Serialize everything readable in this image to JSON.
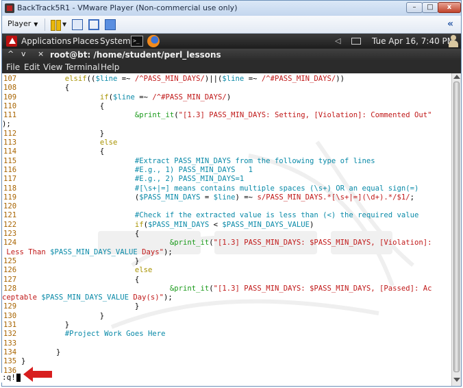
{
  "vmware": {
    "window_title": "BackTrack5R1 - VMware Player (Non-commercial use only)",
    "buttons": {
      "minimize": "–",
      "maximize": "□",
      "close": "x"
    },
    "toolbar": {
      "player_label": "Player",
      "player_caret": "▼",
      "pause_caret": "▼",
      "expand_label": "«"
    }
  },
  "panel": {
    "menus": [
      "Applications",
      "Places",
      "System"
    ],
    "terminal_launcher": ">_",
    "volume_glyph": "◁",
    "clock": "Tue Apr 16,  7:40 PM"
  },
  "terminal": {
    "title_controls": {
      "up": "^",
      "down": "v",
      "close": "×"
    },
    "title": "root@bt: /home/student/perl_lessons",
    "menus": [
      "File",
      "Edit",
      "View",
      "Terminal",
      "Help"
    ],
    "colors": {
      "line_number": "#a86400",
      "keyword": "#a89300",
      "variable": "#0a8aa8",
      "string": "#c01818",
      "function": "#1a9a1a",
      "comment": "#0a8aa8",
      "plain": "#000000"
    },
    "code_lines": [
      {
        "n": "107",
        "segs": [
          [
            "plain",
            "          "
          ],
          [
            "keyword",
            "elsif"
          ],
          [
            "plain",
            "(("
          ],
          [
            "variable",
            "$line"
          ],
          [
            "plain",
            " =~ "
          ],
          [
            "string",
            "/^PASS_MIN_DAYS/"
          ],
          [
            "plain",
            ")||("
          ],
          [
            "variable",
            "$line"
          ],
          [
            "plain",
            " =~ "
          ],
          [
            "string",
            "/^#PASS_MIN_DAYS/"
          ],
          [
            "plain",
            "))"
          ]
        ]
      },
      {
        "n": "108",
        "segs": [
          [
            "plain",
            "          {"
          ]
        ]
      },
      {
        "n": "109",
        "segs": [
          [
            "plain",
            "                  "
          ],
          [
            "keyword",
            "if"
          ],
          [
            "plain",
            "("
          ],
          [
            "variable",
            "$line"
          ],
          [
            "plain",
            " =~ "
          ],
          [
            "string",
            "/^#PASS_MIN_DAYS/"
          ],
          [
            "plain",
            ")"
          ]
        ]
      },
      {
        "n": "110",
        "segs": [
          [
            "plain",
            "                  {"
          ]
        ]
      },
      {
        "n": "111",
        "segs": [
          [
            "plain",
            "                          "
          ],
          [
            "function",
            "&print_it"
          ],
          [
            "plain",
            "("
          ],
          [
            "string",
            "\"[1.3] PASS_MIN_DAYS: Setting, [Violation]: Commented Out\""
          ]
        ]
      },
      {
        "n": "",
        "segs": [
          [
            "plain",
            ");"
          ]
        ]
      },
      {
        "n": "112",
        "segs": [
          [
            "plain",
            "                  }"
          ]
        ]
      },
      {
        "n": "113",
        "segs": [
          [
            "plain",
            "                  "
          ],
          [
            "keyword",
            "else"
          ]
        ]
      },
      {
        "n": "114",
        "segs": [
          [
            "plain",
            "                  {"
          ]
        ]
      },
      {
        "n": "115",
        "segs": [
          [
            "plain",
            "                          "
          ],
          [
            "comment",
            "#Extract PASS_MIN_DAYS from the following type of lines"
          ]
        ]
      },
      {
        "n": "116",
        "segs": [
          [
            "plain",
            "                          "
          ],
          [
            "comment",
            "#E.g., 1) PASS_MIN_DAYS   1"
          ]
        ]
      },
      {
        "n": "117",
        "segs": [
          [
            "plain",
            "                          "
          ],
          [
            "comment",
            "#E.g., 2) PASS_MIN_DAYS=1"
          ]
        ]
      },
      {
        "n": "118",
        "segs": [
          [
            "plain",
            "                          "
          ],
          [
            "comment",
            "#[\\s+|=] means contains multiple spaces (\\s+) OR an equal sign(=)"
          ]
        ]
      },
      {
        "n": "119",
        "segs": [
          [
            "plain",
            "                          ("
          ],
          [
            "variable",
            "$PASS_MIN_DAYS"
          ],
          [
            "plain",
            " = "
          ],
          [
            "variable",
            "$line"
          ],
          [
            "plain",
            ") =~ "
          ],
          [
            "string",
            "s/PASS_MIN_DAYS.*[\\s+|=](\\d+).*/$1/"
          ],
          [
            "plain",
            ";"
          ]
        ]
      },
      {
        "n": "120",
        "segs": [
          [
            "plain",
            ""
          ]
        ]
      },
      {
        "n": "121",
        "segs": [
          [
            "plain",
            "                          "
          ],
          [
            "comment",
            "#Check if the extracted value is less than (<) the required value"
          ]
        ]
      },
      {
        "n": "122",
        "segs": [
          [
            "plain",
            "                          "
          ],
          [
            "keyword",
            "if"
          ],
          [
            "plain",
            "("
          ],
          [
            "variable",
            "$PASS_MIN_DAYS"
          ],
          [
            "plain",
            " < "
          ],
          [
            "variable",
            "$PASS_MIN_DAYS_VALUE"
          ],
          [
            "plain",
            ")"
          ]
        ]
      },
      {
        "n": "123",
        "segs": [
          [
            "plain",
            "                          {"
          ]
        ]
      },
      {
        "n": "124",
        "segs": [
          [
            "plain",
            "                                  "
          ],
          [
            "function",
            "&print_it"
          ],
          [
            "plain",
            "("
          ],
          [
            "string",
            "\"[1.3] PASS_MIN_DAYS: $PASS_MIN_DAYS, [Violation]:"
          ]
        ]
      },
      {
        "n": "",
        "segs": [
          [
            "string",
            " Less Than "
          ],
          [
            "variable",
            "$PASS_MIN_DAYS_VALUE"
          ],
          [
            "string",
            " Days\""
          ],
          [
            "plain",
            ");"
          ]
        ]
      },
      {
        "n": "125",
        "segs": [
          [
            "plain",
            "                          }"
          ]
        ]
      },
      {
        "n": "126",
        "segs": [
          [
            "plain",
            "                          "
          ],
          [
            "keyword",
            "else"
          ]
        ]
      },
      {
        "n": "127",
        "segs": [
          [
            "plain",
            "                          {"
          ]
        ]
      },
      {
        "n": "128",
        "segs": [
          [
            "plain",
            "                                  "
          ],
          [
            "function",
            "&print_it"
          ],
          [
            "plain",
            "("
          ],
          [
            "string",
            "\"[1.3] PASS_MIN_DAYS: $PASS_MIN_DAYS, [Passed]: Ac"
          ]
        ]
      },
      {
        "n": "",
        "segs": [
          [
            "string",
            "ceptable "
          ],
          [
            "variable",
            "$PASS_MIN_DAYS_VALUE"
          ],
          [
            "string",
            " Day(s)\""
          ],
          [
            "plain",
            ");"
          ]
        ]
      },
      {
        "n": "129",
        "segs": [
          [
            "plain",
            "                          }"
          ]
        ]
      },
      {
        "n": "130",
        "segs": [
          [
            "plain",
            "                  }"
          ]
        ]
      },
      {
        "n": "131",
        "segs": [
          [
            "plain",
            "          }"
          ]
        ]
      },
      {
        "n": "132",
        "segs": [
          [
            "plain",
            "          "
          ],
          [
            "comment",
            "#Project Work Goes Here"
          ]
        ]
      },
      {
        "n": "133",
        "segs": [
          [
            "plain",
            ""
          ]
        ]
      },
      {
        "n": "134",
        "segs": [
          [
            "plain",
            "        }"
          ]
        ]
      },
      {
        "n": "135",
        "segs": [
          [
            "plain",
            "}"
          ]
        ]
      },
      {
        "n": "136",
        "segs": [
          [
            "plain",
            ""
          ]
        ]
      }
    ],
    "command_line": ":q!",
    "arrow_color": "#d81e1e"
  }
}
